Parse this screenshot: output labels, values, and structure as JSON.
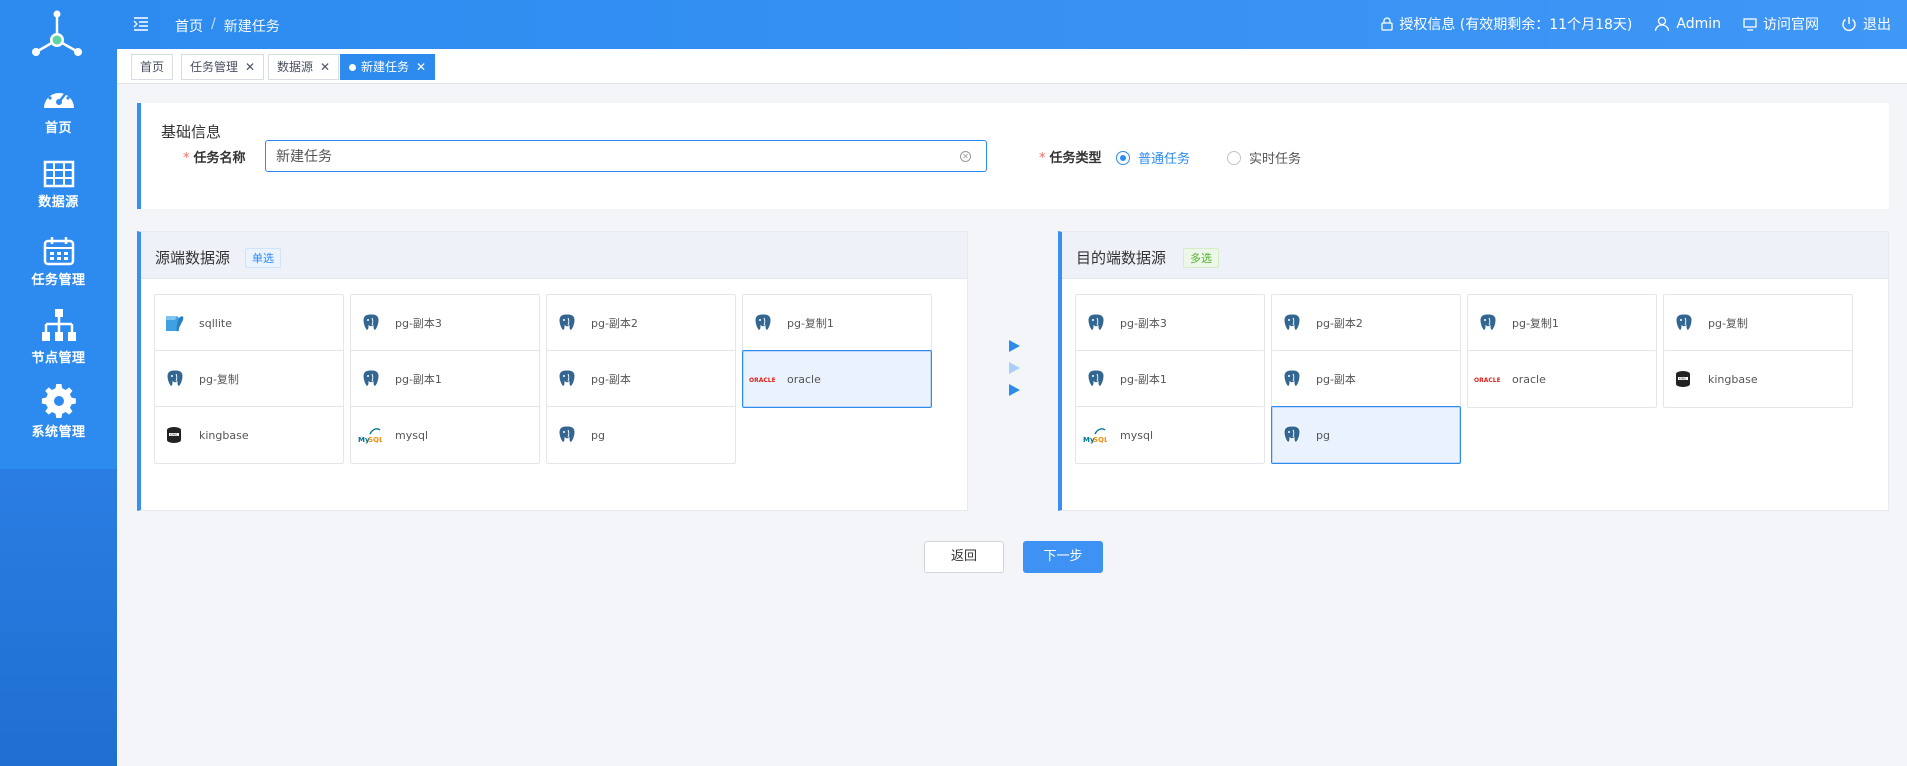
{
  "colors": {
    "primary": "#2d8bf0",
    "required": "#f56c6c",
    "multi_badge": "#52b12e"
  },
  "sidebar": {
    "items": [
      {
        "label": "首页",
        "icon": "dashboard-icon"
      },
      {
        "label": "数据源",
        "icon": "table-icon"
      },
      {
        "label": "任务管理",
        "icon": "calendar-icon"
      },
      {
        "label": "节点管理",
        "icon": "hierarchy-icon"
      },
      {
        "label": "系统管理",
        "icon": "gear-icon"
      }
    ]
  },
  "header": {
    "breadcrumb": [
      "首页",
      "新建任务"
    ],
    "breadcrumb_sep": "/",
    "license": "授权信息 (有效期剩余：11个月18天)",
    "user": "Admin",
    "website": "访问官网",
    "logout": "退出"
  },
  "tabs": [
    {
      "label": "首页",
      "closable": false,
      "active": false
    },
    {
      "label": "任务管理",
      "closable": true,
      "active": false
    },
    {
      "label": "数据源",
      "closable": true,
      "active": false
    },
    {
      "label": "新建任务",
      "closable": true,
      "active": true
    }
  ],
  "basic_info": {
    "title": "基础信息",
    "name_label": "任务名称",
    "name_value": "新建任务",
    "type_label": "任务类型",
    "type_options": [
      "普通任务",
      "实时任务"
    ],
    "type_selected": "普通任务"
  },
  "source": {
    "title": "源端数据源",
    "badge": "单选",
    "items": [
      {
        "name": "sqllite",
        "icon": "sqlite-icon",
        "selected": false
      },
      {
        "name": "pg-副本3",
        "icon": "postgresql-icon",
        "selected": false
      },
      {
        "name": "pg-副本2",
        "icon": "postgresql-icon",
        "selected": false
      },
      {
        "name": "pg-复制1",
        "icon": "postgresql-icon",
        "selected": false
      },
      {
        "name": "pg-复制",
        "icon": "postgresql-icon",
        "selected": false
      },
      {
        "name": "pg-副本1",
        "icon": "postgresql-icon",
        "selected": false
      },
      {
        "name": "pg-副本",
        "icon": "postgresql-icon",
        "selected": false
      },
      {
        "name": "oracle",
        "icon": "oracle-icon",
        "selected": true
      },
      {
        "name": "kingbase",
        "icon": "kingbase-icon",
        "selected": false
      },
      {
        "name": "mysql",
        "icon": "mysql-icon",
        "selected": false
      },
      {
        "name": "pg",
        "icon": "postgresql-icon",
        "selected": false
      }
    ]
  },
  "target": {
    "title": "目的端数据源",
    "badge": "多选",
    "items": [
      {
        "name": "pg-副本3",
        "icon": "postgresql-icon",
        "selected": false
      },
      {
        "name": "pg-副本2",
        "icon": "postgresql-icon",
        "selected": false
      },
      {
        "name": "pg-复制1",
        "icon": "postgresql-icon",
        "selected": false
      },
      {
        "name": "pg-复制",
        "icon": "postgresql-icon",
        "selected": false
      },
      {
        "name": "pg-副本1",
        "icon": "postgresql-icon",
        "selected": false
      },
      {
        "name": "pg-副本",
        "icon": "postgresql-icon",
        "selected": false
      },
      {
        "name": "oracle",
        "icon": "oracle-icon",
        "selected": false
      },
      {
        "name": "kingbase",
        "icon": "kingbase-icon",
        "selected": false
      },
      {
        "name": "mysql",
        "icon": "mysql-icon",
        "selected": false
      },
      {
        "name": "pg",
        "icon": "postgresql-icon",
        "selected": true
      }
    ]
  },
  "buttons": {
    "back": "返回",
    "next": "下一步"
  }
}
